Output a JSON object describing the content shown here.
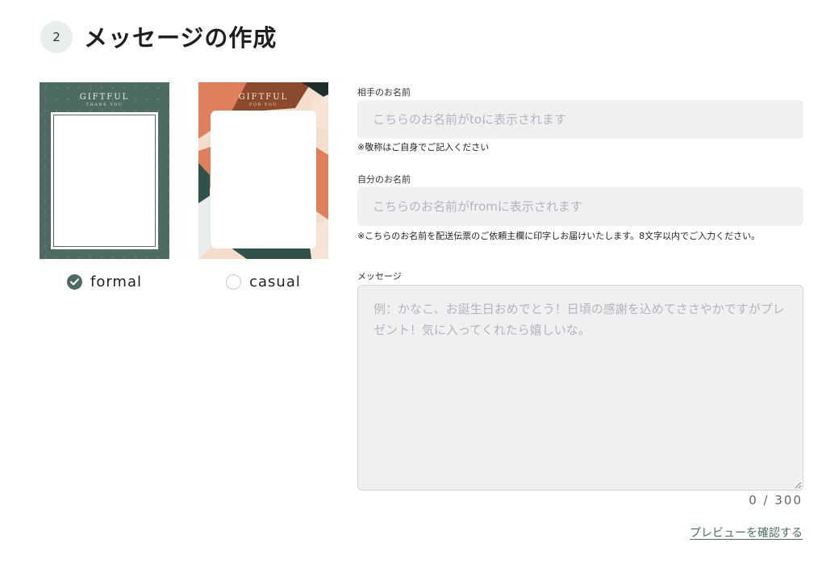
{
  "section": {
    "step_number": "2",
    "title": "メッセージの作成"
  },
  "templates": [
    {
      "label": "formal",
      "selected": true,
      "brand": "GIFTFUL",
      "brand_sub": "THANK YOU"
    },
    {
      "label": "casual",
      "selected": false,
      "brand": "GIFTFUL",
      "brand_sub": "FOR YOU"
    }
  ],
  "form": {
    "recipient": {
      "label": "相手のお名前",
      "placeholder": "こちらのお名前がtoに表示されます",
      "value": "",
      "note": "※敬称はご自身でご記入ください"
    },
    "sender": {
      "label": "自分のお名前",
      "placeholder": "こちらのお名前がfromに表示されます",
      "value": "",
      "note": "※こちらのお名前を配送伝票のご依頼主欄に印字しお届けいたします。8文字以内でご入力ください。"
    },
    "message": {
      "label": "メッセージ",
      "placeholder": "例：かなこ、お誕生日おめでとう！日頃の感謝を込めてささやかですがプレゼント！気に入ってくれたら嬉しいな。",
      "value": "",
      "counter": "0 / 300"
    },
    "preview_link": "プレビューを確認する"
  },
  "colors": {
    "accent": "#4e6b63",
    "input_bg": "#eff0f1",
    "casual_orange": "#e07f5c",
    "casual_brown": "#8b4a2c",
    "casual_peach": "#f3ddcd",
    "casual_teal": "#2f524c"
  },
  "icons": {
    "checked_radio": "check-icon",
    "resize_handle": "resize-grip-icon"
  }
}
